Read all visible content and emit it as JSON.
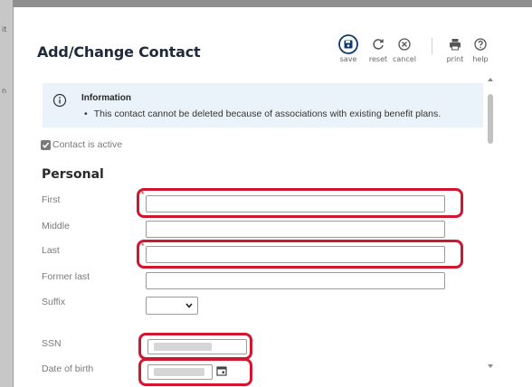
{
  "backdrop": {
    "marks": [
      "it",
      "n"
    ]
  },
  "dialog": {
    "title": "Add/Change Contact",
    "toolbar": {
      "save": "save",
      "reset": "reset",
      "cancel": "cancel",
      "print": "print",
      "help": "help"
    },
    "info": {
      "heading": "Information",
      "message": "This contact cannot be deleted because of associations with existing benefit plans."
    },
    "active": {
      "label": "Contact is active",
      "checked": true
    },
    "personal": {
      "title": "Personal",
      "fields": {
        "first": {
          "label": "First",
          "value": "",
          "required": true
        },
        "middle": {
          "label": "Middle",
          "value": ""
        },
        "last": {
          "label": "Last",
          "value": "",
          "required": true
        },
        "former_last": {
          "label": "Former last",
          "value": ""
        },
        "suffix": {
          "label": "Suffix",
          "value": ""
        },
        "ssn": {
          "label": "SSN"
        },
        "dob": {
          "label": "Date of birth"
        }
      },
      "required_marker": "*"
    },
    "colors": {
      "accent": "#0d3b6e",
      "highlight": "#d2162f",
      "info_bg": "#eaf3fa"
    },
    "icons": {
      "save": "save-floppy-icon",
      "reset": "refresh-icon",
      "cancel": "cancel-circle-x-icon",
      "print": "printer-icon",
      "help": "help-question-icon",
      "info": "info-circle-icon",
      "calendar": "calendar-icon"
    }
  }
}
